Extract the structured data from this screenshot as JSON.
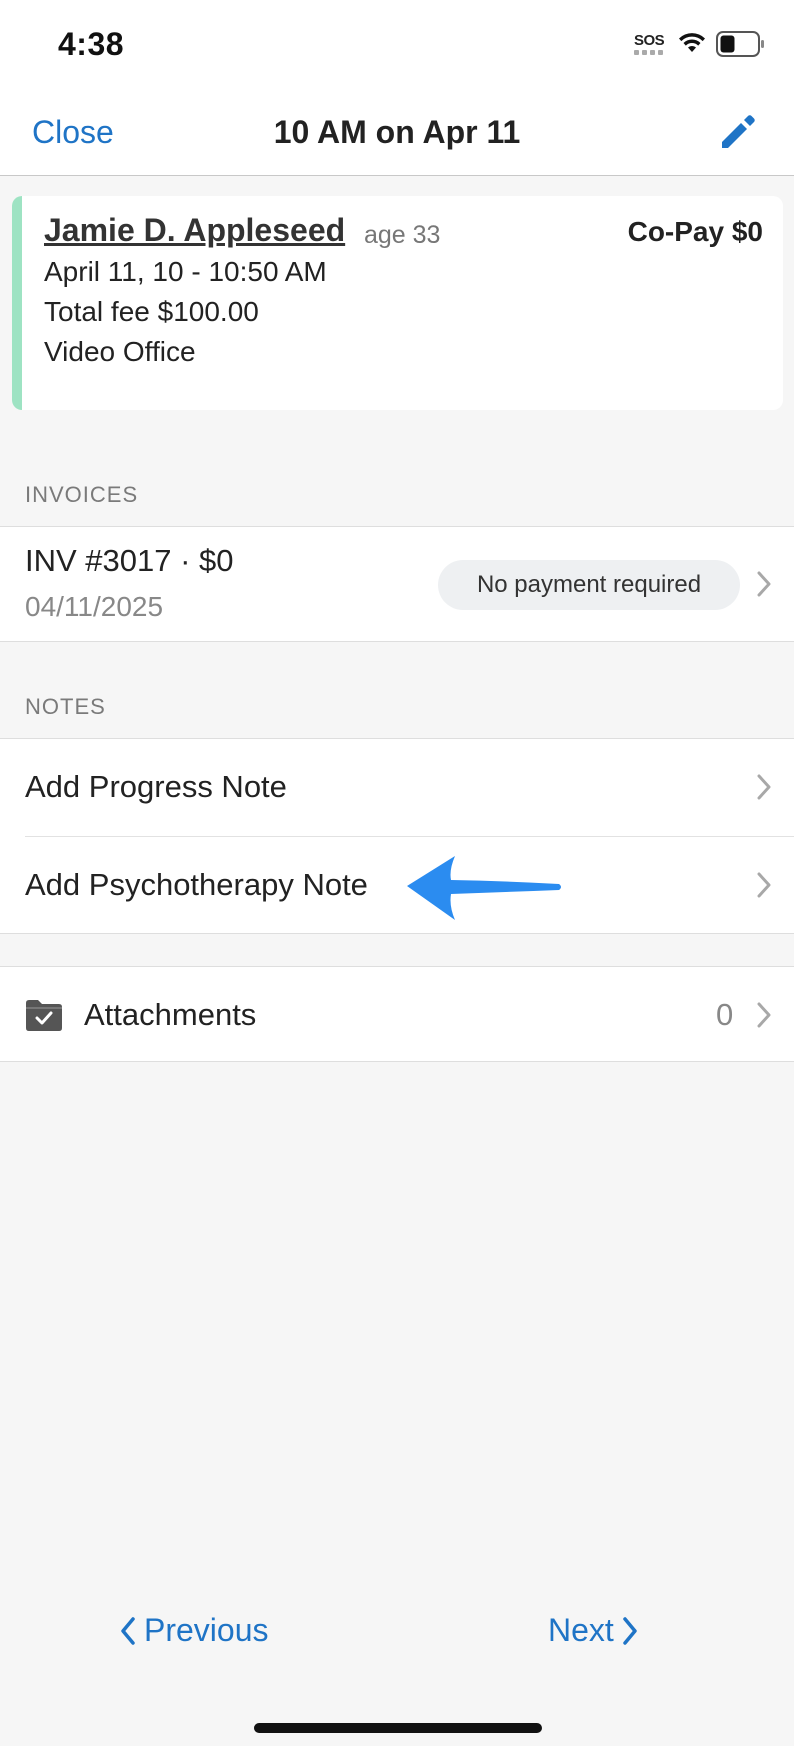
{
  "status_bar": {
    "time": "4:38",
    "sos": "SOS",
    "wifi_icon": "wifi-icon",
    "battery_icon": "battery-icon"
  },
  "nav": {
    "close_label": "Close",
    "title": "10 AM on Apr 11",
    "edit_icon": "pencil-icon",
    "accent_color": "#1f74c6"
  },
  "appointment": {
    "client_name": "Jamie D. Appleseed",
    "age": "age 33",
    "copay": "Co-Pay $0",
    "time_range": "April 11, 10 - 10:50 AM",
    "total_fee": "Total fee $100.00",
    "location": "Video Office",
    "accent_color": "#9ee3c3"
  },
  "invoices": {
    "header": "INVOICES",
    "items": [
      {
        "title": "INV #3017 · $0",
        "date": "04/11/2025",
        "status": "No payment required"
      }
    ]
  },
  "notes": {
    "header": "NOTES",
    "items": [
      {
        "label": "Add Progress Note"
      },
      {
        "label": "Add Psychotherapy Note"
      }
    ]
  },
  "attachments": {
    "label": "Attachments",
    "count": "0",
    "icon": "folder-check-icon"
  },
  "annotation": {
    "icon": "blue-arrow-icon",
    "color": "#2b8cf0"
  },
  "footer": {
    "previous_label": "Previous",
    "next_label": "Next"
  }
}
